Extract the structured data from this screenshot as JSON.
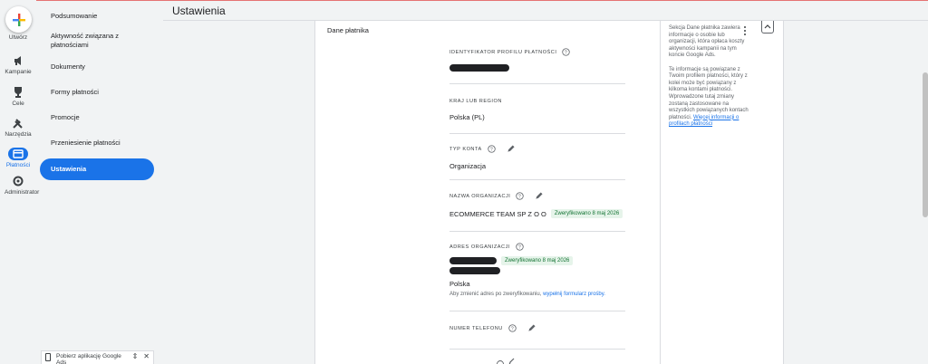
{
  "app": {
    "page_title": "Ustawienia"
  },
  "rail": {
    "create_label": "Utwórz",
    "items": [
      {
        "label": "Kampanie",
        "icon": "megaphone-icon"
      },
      {
        "label": "Cele",
        "icon": "trophy-icon"
      },
      {
        "label": "Narzędzia",
        "icon": "tools-icon"
      },
      {
        "label": "Płatności",
        "icon": "payment-card-icon",
        "active": true
      },
      {
        "label": "Administrator",
        "icon": "gear-icon"
      }
    ]
  },
  "nav": {
    "items": [
      {
        "label": "Podsumowanie"
      },
      {
        "label": "Aktywność związana z płatnościami"
      },
      {
        "label": "Dokumenty"
      },
      {
        "label": "Formy płatności"
      },
      {
        "label": "Promocje"
      },
      {
        "label": "Przeniesienie płatności"
      },
      {
        "label": "Ustawienia",
        "active": true
      }
    ]
  },
  "promo": {
    "label": "Pobierz aplikację Google Ads"
  },
  "card": {
    "title": "Dane płatnika",
    "fields": {
      "profile_id": {
        "label": "Identyfikator profilu płatności"
      },
      "country": {
        "label": "Kraj lub region",
        "value": "Polska (PL)"
      },
      "account_type": {
        "label": "Typ konta",
        "value": "Organizacja"
      },
      "org_name": {
        "label": "Nazwa organizacji",
        "value": "ECOMMERCE TEAM SP Z O O",
        "badge": "Zweryfikowano 8 maj 2026"
      },
      "org_address": {
        "label": "Adres organizacji",
        "badge": "Zweryfikowano 8 maj 2026",
        "country": "Polska",
        "note_prefix": "Aby zmienić adres po zweryfikowaniu,",
        "note_link": "wypełnij formularz prośby."
      },
      "phone": {
        "label": "Numer telefonu"
      }
    },
    "help": {
      "p1": "Sekcja Dane płatnika zawiera informacje o osobie lub organizacji, która opłaca koszty aktywności kampanii na tym koncie Google Ads.",
      "p2": "Te informacje są powiązane z Twoim profilem płatności, który z kolei może być powiązany z kilkoma kontami płatności. Wprowadzone tutaj zmiany zostaną zastosowane na wszystkich powiązanych kontach płatności.",
      "link": "Więcej informacji o profilach płatności"
    }
  },
  "colors": {
    "accent": "#1a73e8",
    "verified_bg": "#e6f4ea",
    "verified_text": "#137333"
  }
}
